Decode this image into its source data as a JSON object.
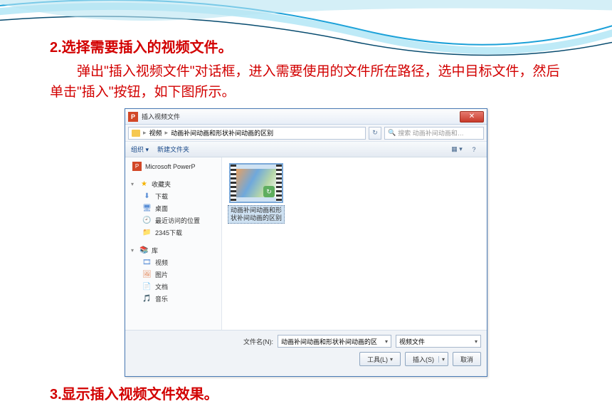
{
  "slide": {
    "step2_title": "2.选择需要插入的视频文件。",
    "step2_body": "弹出\"插入视频文件\"对话框，进入需要使用的文件所在路径，选中目标文件，然后单击\"插入\"按钮，如下图所示。",
    "step3_title": "3.显示插入视频文件效果。"
  },
  "dialog": {
    "title": "插入视频文件",
    "breadcrumb": {
      "root": "视频",
      "folder": "动画补间动画和形状补间动画的区别"
    },
    "search_placeholder": "搜索 动画补间动画和…",
    "toolbar": {
      "organize": "组织 ▾",
      "new_folder": "新建文件夹"
    },
    "nav": {
      "powerpoint": "Microsoft PowerP",
      "favorites": "收藏夹",
      "downloads": "下载",
      "desktop": "桌面",
      "recent": "最近访问的位置",
      "folder2345": "2345下载",
      "libraries": "库",
      "videos": "视频",
      "pictures": "图片",
      "documents": "文档",
      "music": "音乐"
    },
    "file": {
      "name_lines": "动画补间动画和形状补间动画的区别"
    },
    "bottom": {
      "filename_label": "文件名(N):",
      "filename_value": "动画补间动画和形状补间动画的区",
      "filter": "视频文件",
      "tools": "工具(L)",
      "insert": "插入(S)",
      "cancel": "取消"
    }
  }
}
